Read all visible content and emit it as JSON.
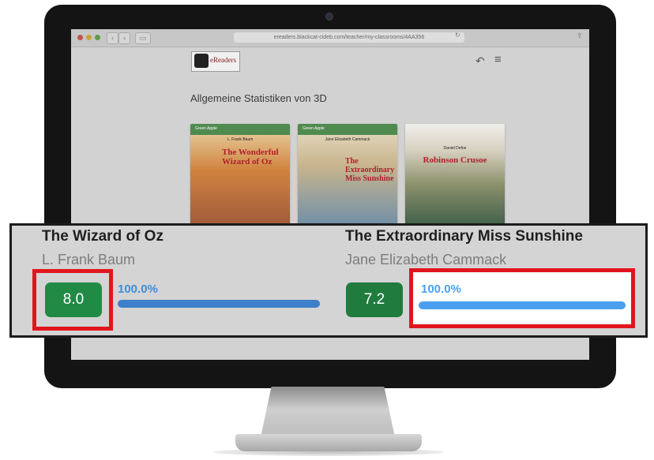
{
  "browser": {
    "url": "ereaders.blackcat-cideb.com/teacher/my-classrooms/4AA356",
    "reload_icon": "↻",
    "share_icon": "⇪",
    "back_nav": "‹",
    "forward_nav": "›",
    "sidebar_toggle": "▭"
  },
  "header": {
    "logo_text": "eReaders",
    "back_icon": "↶",
    "menu_icon": "≡"
  },
  "page": {
    "title": "Allgemeine Statistiken von 3D"
  },
  "covers": [
    {
      "author": "L. Frank Baum",
      "title": "The Wonderful Wizard of Oz",
      "band": "Green Apple"
    },
    {
      "author": "Jane Elizabeth Cammack",
      "title": "The Extraordinary Miss Sunshine",
      "band": "Green Apple"
    },
    {
      "author": "Daniel Defoe",
      "title": "Robinson Crusoe",
      "band": ""
    }
  ],
  "books": [
    {
      "title": "The Wizard of Oz",
      "author": "L. Frank Baum",
      "score": "8.0",
      "percent": "100.0%",
      "progress": 1.0
    },
    {
      "title": "The Extraordinary Miss Sunshine",
      "author": "Jane Elizabeth Cammack",
      "score": "7.2",
      "percent": "100.0%",
      "progress": 1.0
    }
  ],
  "colors": {
    "score_green": "#218b45",
    "progress_blue": "#4591da",
    "highlight_red": "#e2151d"
  }
}
